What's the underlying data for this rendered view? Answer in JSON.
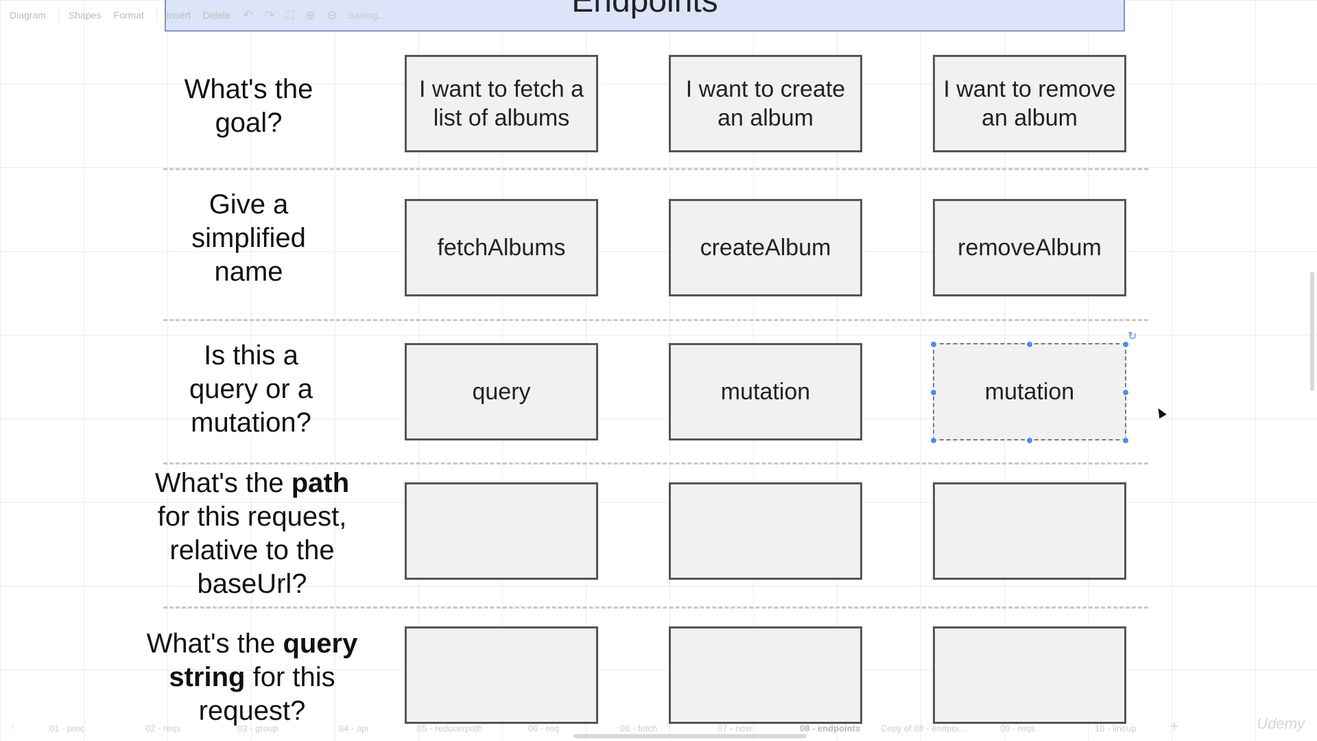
{
  "toolbar": {
    "diagram": "Diagram",
    "shapes": "Shapes",
    "format": "Format",
    "insert": "Insert",
    "delete": "Delete",
    "status": "Saving..."
  },
  "header": {
    "title": "Endpoints"
  },
  "rows": {
    "goal": {
      "label": "What's the goal?"
    },
    "name": {
      "label": "Give a simplified name"
    },
    "type": {
      "label": "Is this a query or a mutation?"
    },
    "path": {
      "label_pre": "What's the ",
      "label_bold": "path",
      "label_post": " for this request, relative to the baseUrl?"
    },
    "qs": {
      "label_pre": "What's the ",
      "label_bold": "query string",
      "label_post": " for this request?"
    }
  },
  "cells": {
    "goal": [
      "I want to fetch a list of albums",
      "I want to create an album",
      "I want to remove an album"
    ],
    "name": [
      "fetchAlbums",
      "createAlbum",
      "removeAlbum"
    ],
    "type": [
      "query",
      "mutation",
      "mutation"
    ],
    "path": [
      "",
      "",
      ""
    ],
    "qs": [
      "",
      "",
      ""
    ]
  },
  "page_tabs": [
    "01 - proc",
    "02 - reqs",
    "03 - group",
    "04 - api",
    "05 - reducerpath",
    "06 - req",
    "06 - fetch",
    "07 - now",
    "08 - endpoints",
    "Copy of 08 - endpoi...",
    "09 - reqs",
    "10 - lineup"
  ],
  "active_tab": "08 - endpoints",
  "watermark": "Udemy"
}
